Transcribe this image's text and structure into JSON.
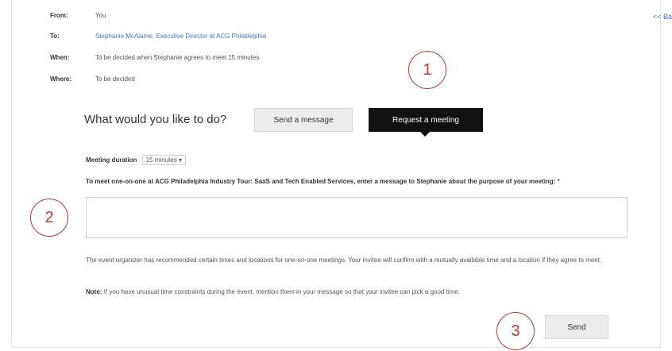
{
  "header": {
    "from_label": "From:",
    "from_value": "You",
    "to_label": "To:",
    "to_value": "Stephanie McAlarne, Executive Director at ACG Philadelphia",
    "when_label": "When:",
    "when_value": "To be decided when Stephanie agrees to meet 15 minutes",
    "where_label": "Where:",
    "where_value": "To be decided",
    "back_link": "<< Ba"
  },
  "choice": {
    "question": "What would you like to do?",
    "send_message_label": "Send a message",
    "request_meeting_label": "Request a meeting"
  },
  "meeting": {
    "duration_label": "Meeting duration",
    "duration_value": "15 minutes ▾",
    "prompt": "To meet one-on-one at ACG Philadelphia Industry Tour: SaaS and Tech Enabled Services, enter a message to Stephanie about the purpose of your meeting:",
    "required_mark": "*",
    "message_value": "",
    "info_text": "The event organizer has recommended certain times and locations for one-on-one meetings. Your invitee will confirm with a mutually available time and a location if they agree to meet.",
    "note_label": "Note:",
    "note_text": "If you have unusual time constraints during the event, mention them in your message so that your invitee can pick a good time."
  },
  "actions": {
    "send_label": "Send"
  },
  "callouts": {
    "one": "1",
    "two": "2",
    "three": "3"
  },
  "colors": {
    "accent_link": "#3a7bc8",
    "callout": "#c0392b",
    "primary_button": "#111111"
  }
}
